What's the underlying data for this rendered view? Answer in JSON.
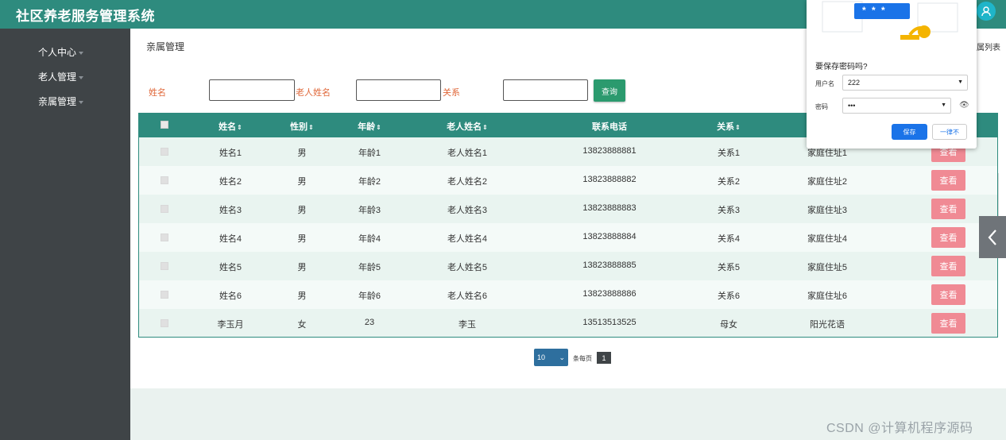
{
  "header": {
    "app_title": "社区养老服务管理系统"
  },
  "sidebar": {
    "items": [
      {
        "label": "个人中心"
      },
      {
        "label": "老人管理"
      },
      {
        "label": "亲属管理"
      }
    ]
  },
  "main": {
    "page_title": "亲属管理",
    "breadcrumb_right": "属列表"
  },
  "search": {
    "name_label": "姓名",
    "name_value": "",
    "elder_label": "老人姓名",
    "elder_value": "",
    "relation_label": "关系",
    "relation_value": "",
    "button_label": "查询"
  },
  "table": {
    "columns": [
      "姓名",
      "性别",
      "年龄",
      "老人姓名",
      "联系电话",
      "关系"
    ],
    "sort_glyph": "⇕",
    "view_label": "查看",
    "rows": [
      {
        "name": "姓名1",
        "gender": "男",
        "age": "年龄1",
        "elder": "老人姓名1",
        "phone": "13823888881",
        "relation": "关系1",
        "address": "家庭住址1"
      },
      {
        "name": "姓名2",
        "gender": "男",
        "age": "年龄2",
        "elder": "老人姓名2",
        "phone": "13823888882",
        "relation": "关系2",
        "address": "家庭住址2"
      },
      {
        "name": "姓名3",
        "gender": "男",
        "age": "年龄3",
        "elder": "老人姓名3",
        "phone": "13823888883",
        "relation": "关系3",
        "address": "家庭住址3"
      },
      {
        "name": "姓名4",
        "gender": "男",
        "age": "年龄4",
        "elder": "老人姓名4",
        "phone": "13823888884",
        "relation": "关系4",
        "address": "家庭住址4"
      },
      {
        "name": "姓名5",
        "gender": "男",
        "age": "年龄5",
        "elder": "老人姓名5",
        "phone": "13823888885",
        "relation": "关系5",
        "address": "家庭住址5"
      },
      {
        "name": "姓名6",
        "gender": "男",
        "age": "年龄6",
        "elder": "老人姓名6",
        "phone": "13823888886",
        "relation": "关系6",
        "address": "家庭住址6"
      },
      {
        "name": "李玉月",
        "gender": "女",
        "age": "23",
        "elder": "李玉",
        "phone": "13513513525",
        "relation": "母女",
        "address": "阳光花语"
      }
    ]
  },
  "pagination": {
    "page_size": "10",
    "per_page_text": "条每页",
    "current_page": "1"
  },
  "password_popup": {
    "question": "要保存密码吗?",
    "username_label": "用户名",
    "username_value": "222",
    "password_label": "密码",
    "password_value": "•••",
    "save_label": "保存",
    "never_label": "一律不",
    "illustration_text": "* * *"
  },
  "watermark": "CSDN @计算机程序源码",
  "colors": {
    "header": "#2e8b7e",
    "sidebar": "#3f4447",
    "view_button": "#f08a94",
    "search_button": "#2b9a6e",
    "accent_label": "#e0683a"
  }
}
